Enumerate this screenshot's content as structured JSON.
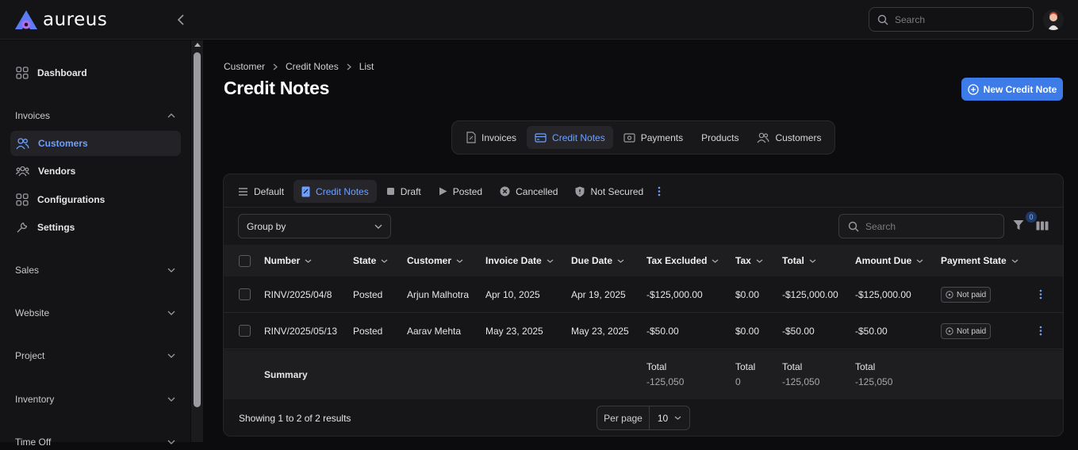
{
  "app": {
    "name": "aureus"
  },
  "topbar": {
    "search_placeholder": "Search"
  },
  "sidebar": {
    "dashboard": "Dashboard",
    "groups": {
      "invoices": "Invoices",
      "sales": "Sales",
      "website": "Website",
      "project": "Project",
      "inventory": "Inventory",
      "timeoff": "Time Off"
    },
    "items": {
      "customers": "Customers",
      "vendors": "Vendors",
      "configurations": "Configurations",
      "settings": "Settings"
    }
  },
  "breadcrumb": [
    "Customer",
    "Credit Notes",
    "List"
  ],
  "page": {
    "title": "Credit Notes",
    "new_button": "New Credit Note"
  },
  "module_tabs": [
    "Invoices",
    "Credit Notes",
    "Payments",
    "Products",
    "Customers"
  ],
  "filter_tabs": [
    "Default",
    "Credit Notes",
    "Draft",
    "Posted",
    "Cancelled",
    "Not Secured"
  ],
  "toolbar": {
    "group_by": "Group by",
    "search_placeholder": "Search",
    "filter_count": "0"
  },
  "table": {
    "headers": [
      "Number",
      "State",
      "Customer",
      "Invoice Date",
      "Due Date",
      "Tax Excluded",
      "Tax",
      "Total",
      "Amount Due",
      "Payment State"
    ],
    "rows": [
      {
        "number": "RINV/2025/04/8",
        "state": "Posted",
        "customer": "Arjun Malhotra",
        "invoice_date": "Apr 10, 2025",
        "due_date": "Apr 19, 2025",
        "tax_excluded": "-$125,000.00",
        "tax": "$0.00",
        "total": "-$125,000.00",
        "amount_due": "-$125,000.00",
        "payment_state": "Not paid"
      },
      {
        "number": "RINV/2025/05/13",
        "state": "Posted",
        "customer": "Aarav Mehta",
        "invoice_date": "May 23, 2025",
        "due_date": "May 23, 2025",
        "tax_excluded": "-$50.00",
        "tax": "$0.00",
        "total": "-$50.00",
        "amount_due": "-$50.00",
        "payment_state": "Not paid"
      }
    ],
    "summary": {
      "label": "Summary",
      "total_label": "Total",
      "tax_excluded": "-125,050",
      "tax": "0",
      "total": "-125,050",
      "amount_due": "-125,050"
    }
  },
  "footer": {
    "results": "Showing 1 to 2 of 2 results",
    "per_page_label": "Per page",
    "per_page_value": "10"
  },
  "colors": {
    "accent": "#3d7be8",
    "active_text": "#6ea0ff",
    "background": "#0c0c0e"
  }
}
